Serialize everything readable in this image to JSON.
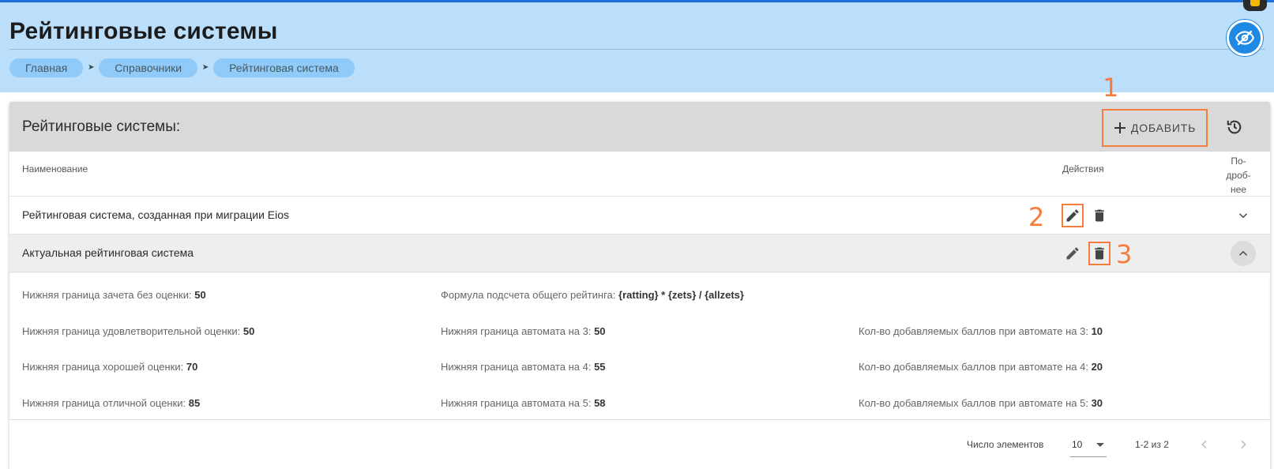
{
  "header": {
    "title": "Рейтинговые системы",
    "breadcrumbs": [
      "Главная",
      "Справочники",
      "Рейтинговая система"
    ]
  },
  "panel": {
    "title": "Рейтинговые системы:",
    "add_label": "ДОБАВИТЬ",
    "columns": {
      "name": "Наименование",
      "actions": "Действия",
      "more": [
        "По-",
        "дроб-",
        "нее"
      ]
    },
    "rows": [
      {
        "name": "Рейтинговая система, созданная при миграции Eios",
        "expanded": false
      },
      {
        "name": "Актуальная рейтинговая система",
        "expanded": true
      }
    ],
    "details": {
      "col1": [
        {
          "label": "Нижняя граница зачета без оценки:",
          "value": "50"
        },
        {
          "label": "Нижняя граница удовлетворительной оценки:",
          "value": "50"
        },
        {
          "label": "Нижняя граница хорошей оценки:",
          "value": "70"
        },
        {
          "label": "Нижняя граница отличной оценки:",
          "value": "85"
        }
      ],
      "col2": [
        {
          "label": "Формула подсчета общего рейтинга:",
          "value": "{ratting} * {zets} / {allzets}"
        },
        {
          "label": "Нижняя граница автомата на 3:",
          "value": "50"
        },
        {
          "label": "Нижняя граница автомата на 4:",
          "value": "55"
        },
        {
          "label": "Нижняя граница автомата на 5:",
          "value": "58"
        }
      ],
      "col3": [
        {
          "label": "Кол-во добавляемых баллов при автомате на 3:",
          "value": "10"
        },
        {
          "label": "Кол-во добавляемых баллов при автомате на 4:",
          "value": "20"
        },
        {
          "label": "Кол-во добавляемых баллов при автомате на 5:",
          "value": "30"
        }
      ]
    },
    "pagination": {
      "items_label": "Число элементов",
      "page_size": "10",
      "range": "1-2 из 2"
    }
  },
  "annotations": [
    "1",
    "2",
    "3"
  ],
  "colors": {
    "header_bg": "#bbdefb",
    "accent": "#1e88e5",
    "annotation": "#f47c3c"
  },
  "icons": [
    "eye-off-icon",
    "plus-icon",
    "history-icon",
    "pencil-icon",
    "trash-icon",
    "chevron-down-icon",
    "chevron-up-icon",
    "chevron-left-icon",
    "chevron-right-icon",
    "dropdown-arrow-icon"
  ]
}
